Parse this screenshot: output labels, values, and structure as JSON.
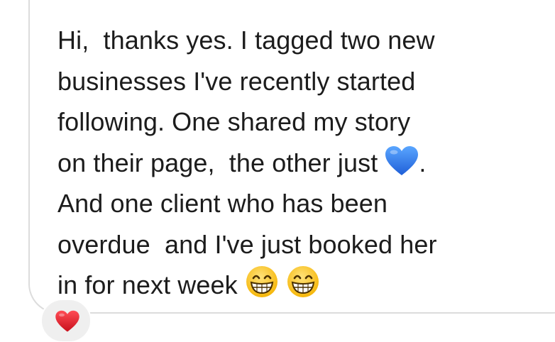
{
  "message": {
    "lines": [
      "Hi,  thanks yes. I tagged two new",
      "businesses I've recently started",
      "following. One shared my story",
      "on their page,  the other just",
      "And one client who has been",
      "overdue  and I've just booked her",
      "in for next week"
    ],
    "line4_after_emoji": ".",
    "inline_emojis": {
      "line4": "blue-heart-icon",
      "line7": [
        "grinning-face-icon",
        "grinning-face-icon"
      ]
    }
  },
  "reaction": {
    "icon": "red-heart-icon",
    "color": "#e0252f"
  },
  "colors": {
    "text": "#1c1c1c",
    "bubble_border": "#dcdcdc",
    "reaction_bg": "#efefef",
    "blue_heart": "#2f7be8"
  }
}
